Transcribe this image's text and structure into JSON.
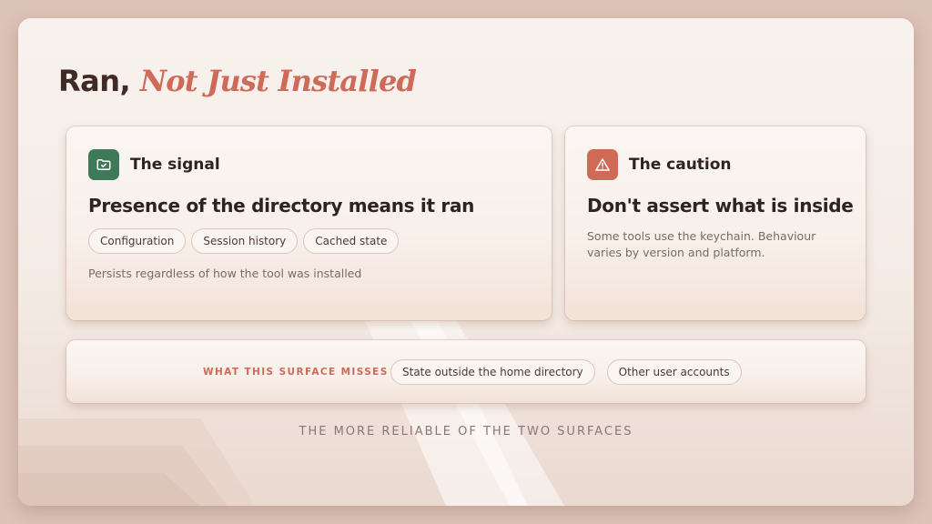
{
  "title": {
    "plain": "Ran,",
    "accent": "Not Just Installed"
  },
  "signal_card": {
    "label": "The signal",
    "icon": "folder-check-icon",
    "heading": "Presence of the directory means it ran",
    "chips": [
      "Configuration",
      "Session history",
      "Cached state"
    ],
    "note": "Persists regardless of how the tool was installed"
  },
  "caution_card": {
    "label": "The caution",
    "icon": "warning-triangle-icon",
    "heading": "Don't assert what is inside",
    "text": "Some tools use the keychain. Behaviour varies by version and platform."
  },
  "misses_card": {
    "label": "WHAT THIS SURFACE MISSES",
    "chips": [
      "State outside the home directory",
      "Other user accounts"
    ]
  },
  "footer": "THE MORE RELIABLE OF THE TWO SURFACES",
  "colors": {
    "accent": "#cf6a58",
    "signal_icon_bg": "#3e7a5a",
    "caution_icon_bg": "#d06a57",
    "text_dark": "#2f2320"
  }
}
